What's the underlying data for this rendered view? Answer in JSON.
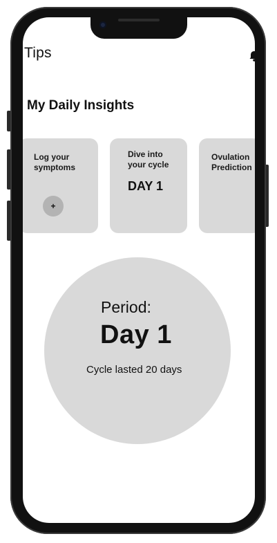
{
  "header": {
    "title": "Tips",
    "bell_icon": "bell-icon"
  },
  "insights": {
    "title": "My Daily Insights",
    "cards": [
      {
        "line1": "Log your",
        "line2": "symptoms",
        "button_label": "+"
      },
      {
        "line1": "Dive into",
        "line2": "your cycle",
        "value": "DAY 1"
      },
      {
        "line1": "Ovulation",
        "line2": "Prediction"
      }
    ]
  },
  "period": {
    "label": "Period:",
    "day": "Day 1",
    "cycle_text": "Cycle lasted 20 days"
  },
  "colors": {
    "card_bg": "#d9d9d9",
    "add_button_bg": "#b3b3b3",
    "frame": "#111111"
  }
}
